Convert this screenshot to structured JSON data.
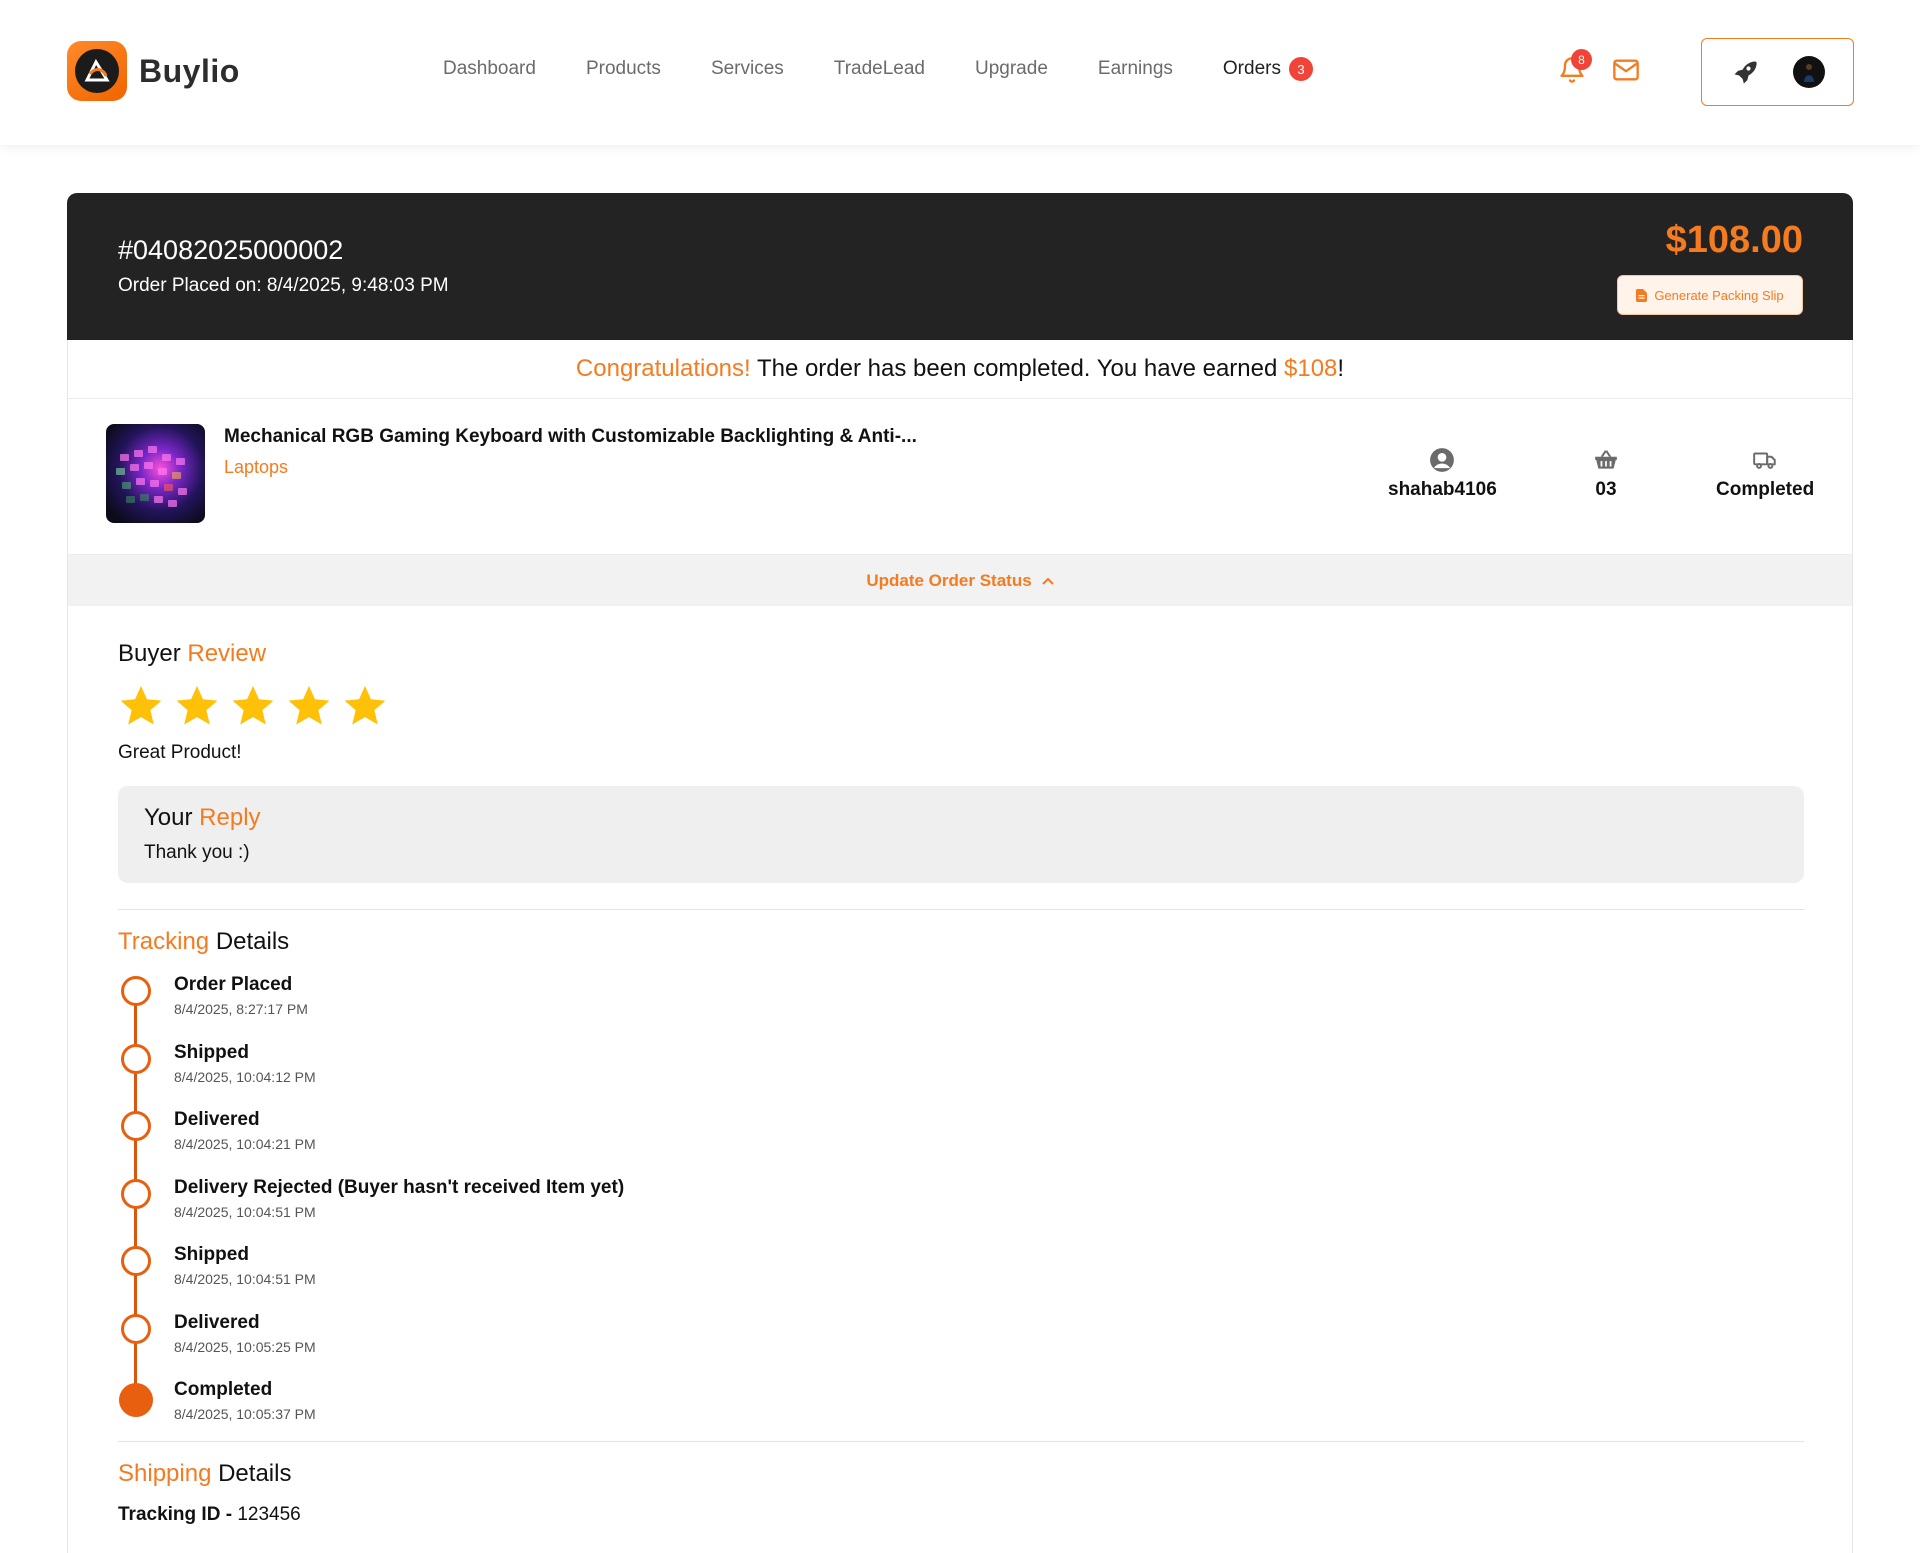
{
  "header": {
    "brand": "Buylio",
    "nav": [
      {
        "label": "Dashboard"
      },
      {
        "label": "Products"
      },
      {
        "label": "Services"
      },
      {
        "label": "TradeLead"
      },
      {
        "label": "Upgrade"
      },
      {
        "label": "Earnings"
      },
      {
        "label": "Orders",
        "badge": "3"
      }
    ],
    "notifications_count": "8",
    "icons": [
      "bell-icon",
      "mail-icon",
      "rocket-icon",
      "avatar"
    ],
    "accent": "#f47b20"
  },
  "order": {
    "id": "#04082025000002",
    "placed_label": "Order Placed on: 8/4/2025, 9:48:03 PM",
    "total": "$108.00",
    "packing_slip_label": "Generate Packing Slip"
  },
  "congrats": {
    "prefix": "Congratulations!",
    "middle": " The order has been completed. You have earned ",
    "amount": "$108",
    "suffix": "!"
  },
  "product": {
    "title": "Mechanical RGB Gaming Keyboard with Customizable Backlighting & Anti-...",
    "category": "Laptops",
    "buyer": "shahab4106",
    "quantity": "03",
    "status": "Completed"
  },
  "update_status_label": "Update Order Status",
  "review": {
    "title_a": "Buyer",
    "title_b": "Review",
    "rating": 5,
    "max_rating": 5,
    "text": "Great Product!"
  },
  "reply": {
    "title_a": "Your",
    "title_b": "Reply",
    "text": "Thank you :)"
  },
  "tracking": {
    "title_a": "Tracking",
    "title_b": "Details",
    "events": [
      {
        "label": "Order Placed",
        "time": "8/4/2025, 8:27:17 PM"
      },
      {
        "label": "Shipped",
        "time": "8/4/2025, 10:04:12 PM"
      },
      {
        "label": "Delivered",
        "time": "8/4/2025, 10:04:21 PM"
      },
      {
        "label": "Delivery Rejected (Buyer hasn't received Item yet)",
        "time": "8/4/2025, 10:04:51 PM"
      },
      {
        "label": "Shipped",
        "time": "8/4/2025, 10:04:51 PM"
      },
      {
        "label": "Delivered",
        "time": "8/4/2025, 10:05:25 PM"
      },
      {
        "label": "Completed",
        "time": "8/4/2025, 10:05:37 PM"
      }
    ]
  },
  "shipping": {
    "title_a": "Shipping",
    "title_b": "Details",
    "tracking_id_label": "Tracking ID -",
    "tracking_id": "123456"
  }
}
